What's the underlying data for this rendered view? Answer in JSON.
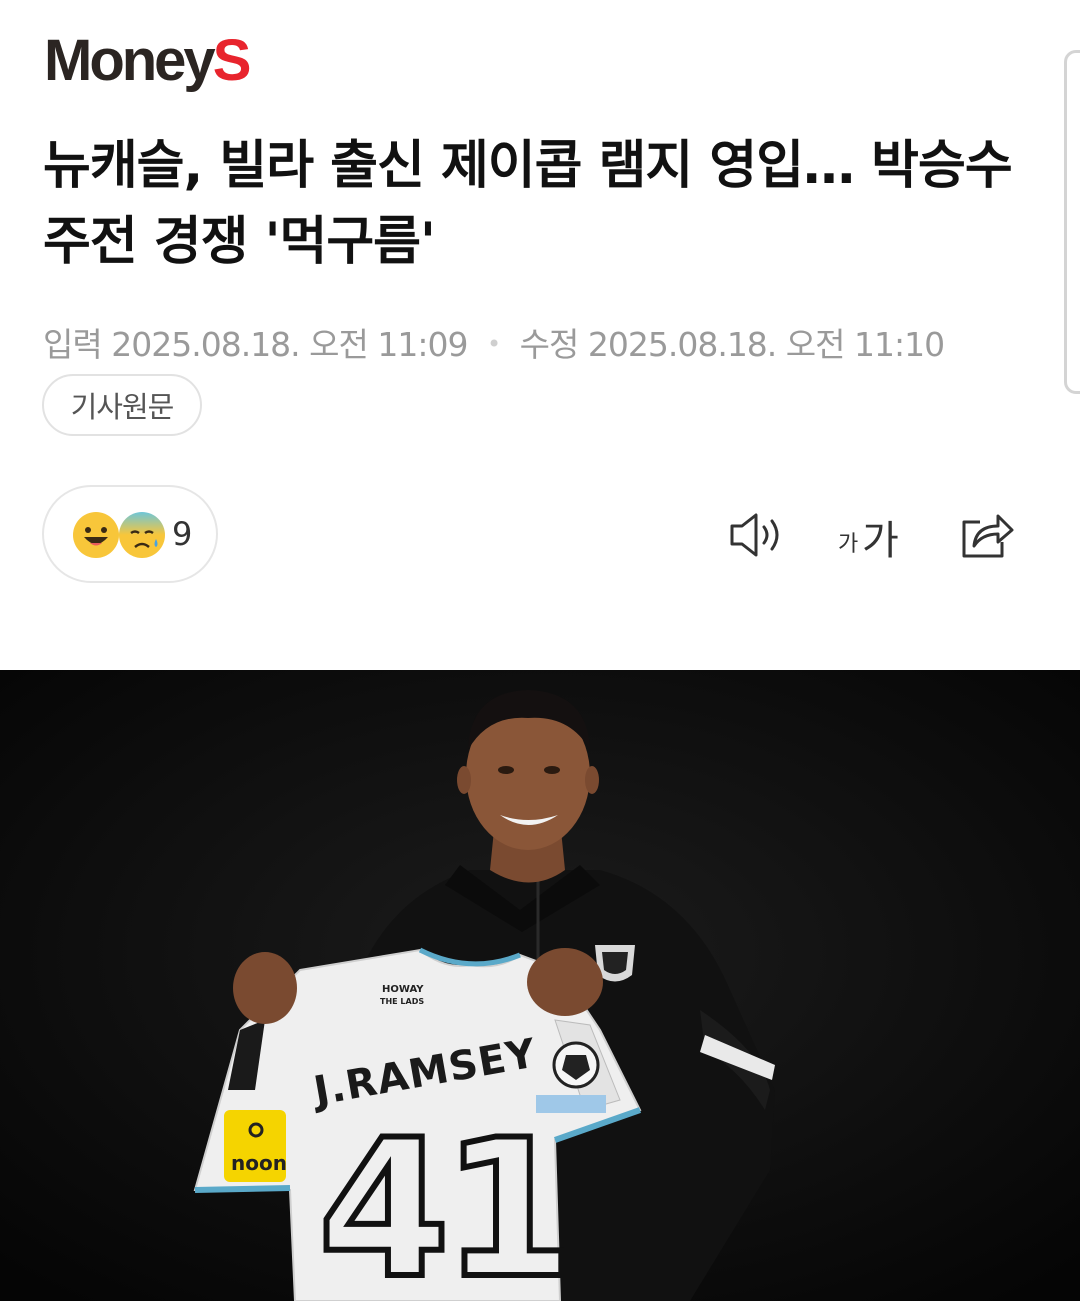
{
  "header": {
    "logo_part1": "Money",
    "logo_part2": "S"
  },
  "article": {
    "title": "뉴캐슬, 빌라 출신 제이콥 램지 영입… 박승수 주전 경쟁 '먹구름'",
    "published_label": "입력",
    "published_value": "2025.08.18. 오전 11:09",
    "modified_label": "수정",
    "modified_value": "2025.08.18. 오전 11:10",
    "original_button": "기사원문"
  },
  "reactions": {
    "count": "9",
    "emoji_icons": [
      "smiling-face-icon",
      "sad-sweat-face-icon"
    ]
  },
  "toolbar": {
    "icons": [
      "speaker-icon",
      "font-size-icon",
      "share-icon"
    ],
    "font_small": "가",
    "font_big": "가"
  },
  "photo": {
    "jersey_name": "J.RAMSEY",
    "jersey_number": "41",
    "sponsor": "noon",
    "collar_text_line1": "HOWAY",
    "collar_text_line2": "THE LADS"
  },
  "colors": {
    "brand_dark": "#2b2522",
    "brand_red": "#e8242d",
    "meta_gray": "#9a9a9a"
  }
}
